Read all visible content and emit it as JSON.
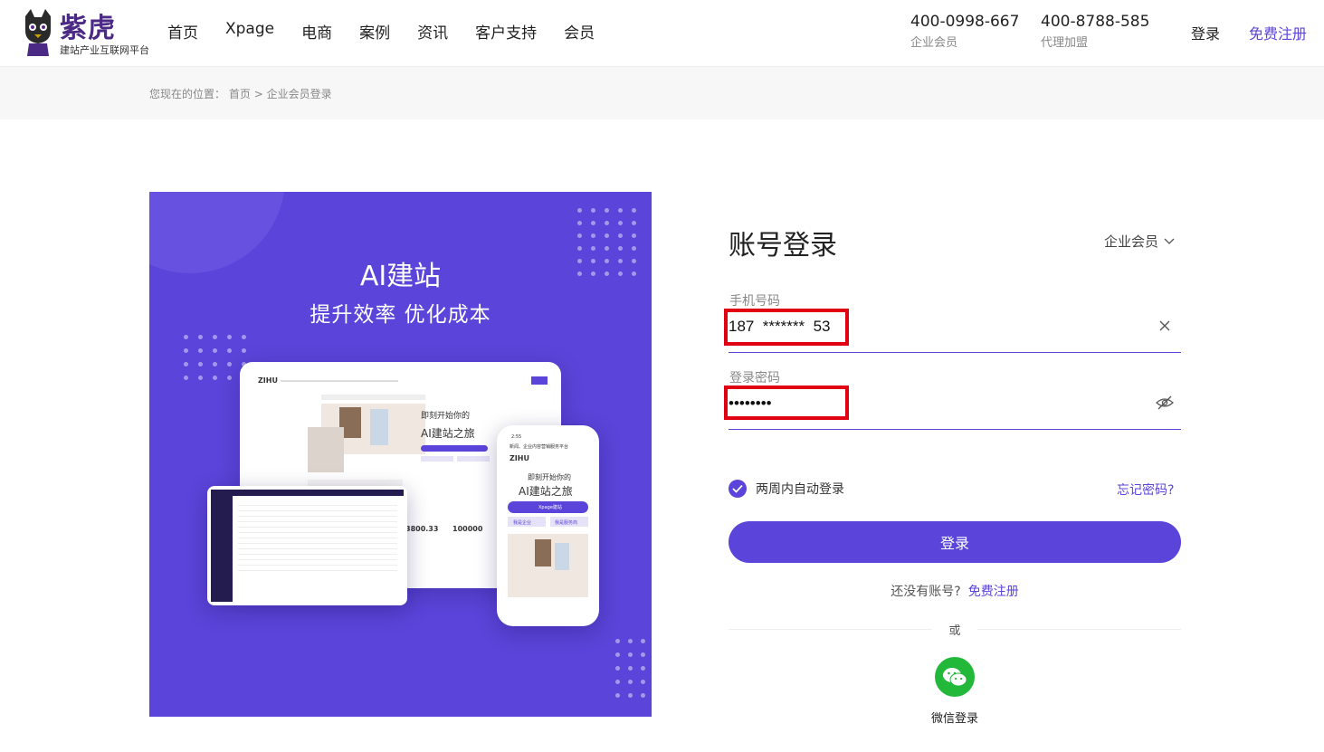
{
  "brand": {
    "name": "紫虎",
    "tagline": "建站产业互联网平台"
  },
  "nav": {
    "items": [
      {
        "label": "首页"
      },
      {
        "label": "Xpage"
      },
      {
        "label": "电商"
      },
      {
        "label": "案例"
      },
      {
        "label": "资讯"
      },
      {
        "label": "客户支持"
      },
      {
        "label": "会员"
      }
    ]
  },
  "contacts": [
    {
      "number": "400-0998-667",
      "caption": "企业会员"
    },
    {
      "number": "400-8788-585",
      "caption": "代理加盟"
    }
  ],
  "header_actions": {
    "login": "登录",
    "register": "免费注册"
  },
  "breadcrumb": {
    "prefix": "您现在的位置：",
    "home": "首页",
    "separator": ">",
    "current": "企业会员登录"
  },
  "hero": {
    "title": "AI建站",
    "subtitle": "提升效率 优化成本",
    "mockup": {
      "logo": "ZIHU",
      "headline_1": "即刻开始你的",
      "headline_2": "AI建站之旅",
      "stat_1": "3800.33",
      "stat_2": "100000",
      "phone_time": "2:55",
      "phone_banner": "新闻、企业内容营销服务平台",
      "phone_button": "Xpage建站",
      "phone_tab_1": "我是企业",
      "phone_tab_2": "我是服务商"
    }
  },
  "login_form": {
    "title": "账号登录",
    "account_type": "企业会员",
    "phone_label": "手机号码",
    "phone_value": "187  *******  53",
    "password_label": "登录密码",
    "password_value": "password",
    "remember_label": "两周内自动登录",
    "remember_checked": true,
    "forgot_label": "忘记密码?",
    "submit_label": "登录",
    "no_account_text": "还没有账号?",
    "register_link": "免费注册",
    "or_text": "或",
    "wechat_label": "微信登录"
  },
  "colors": {
    "accent": "#5b44d9",
    "highlight_box": "#e00012",
    "wechat": "#22b83a"
  }
}
